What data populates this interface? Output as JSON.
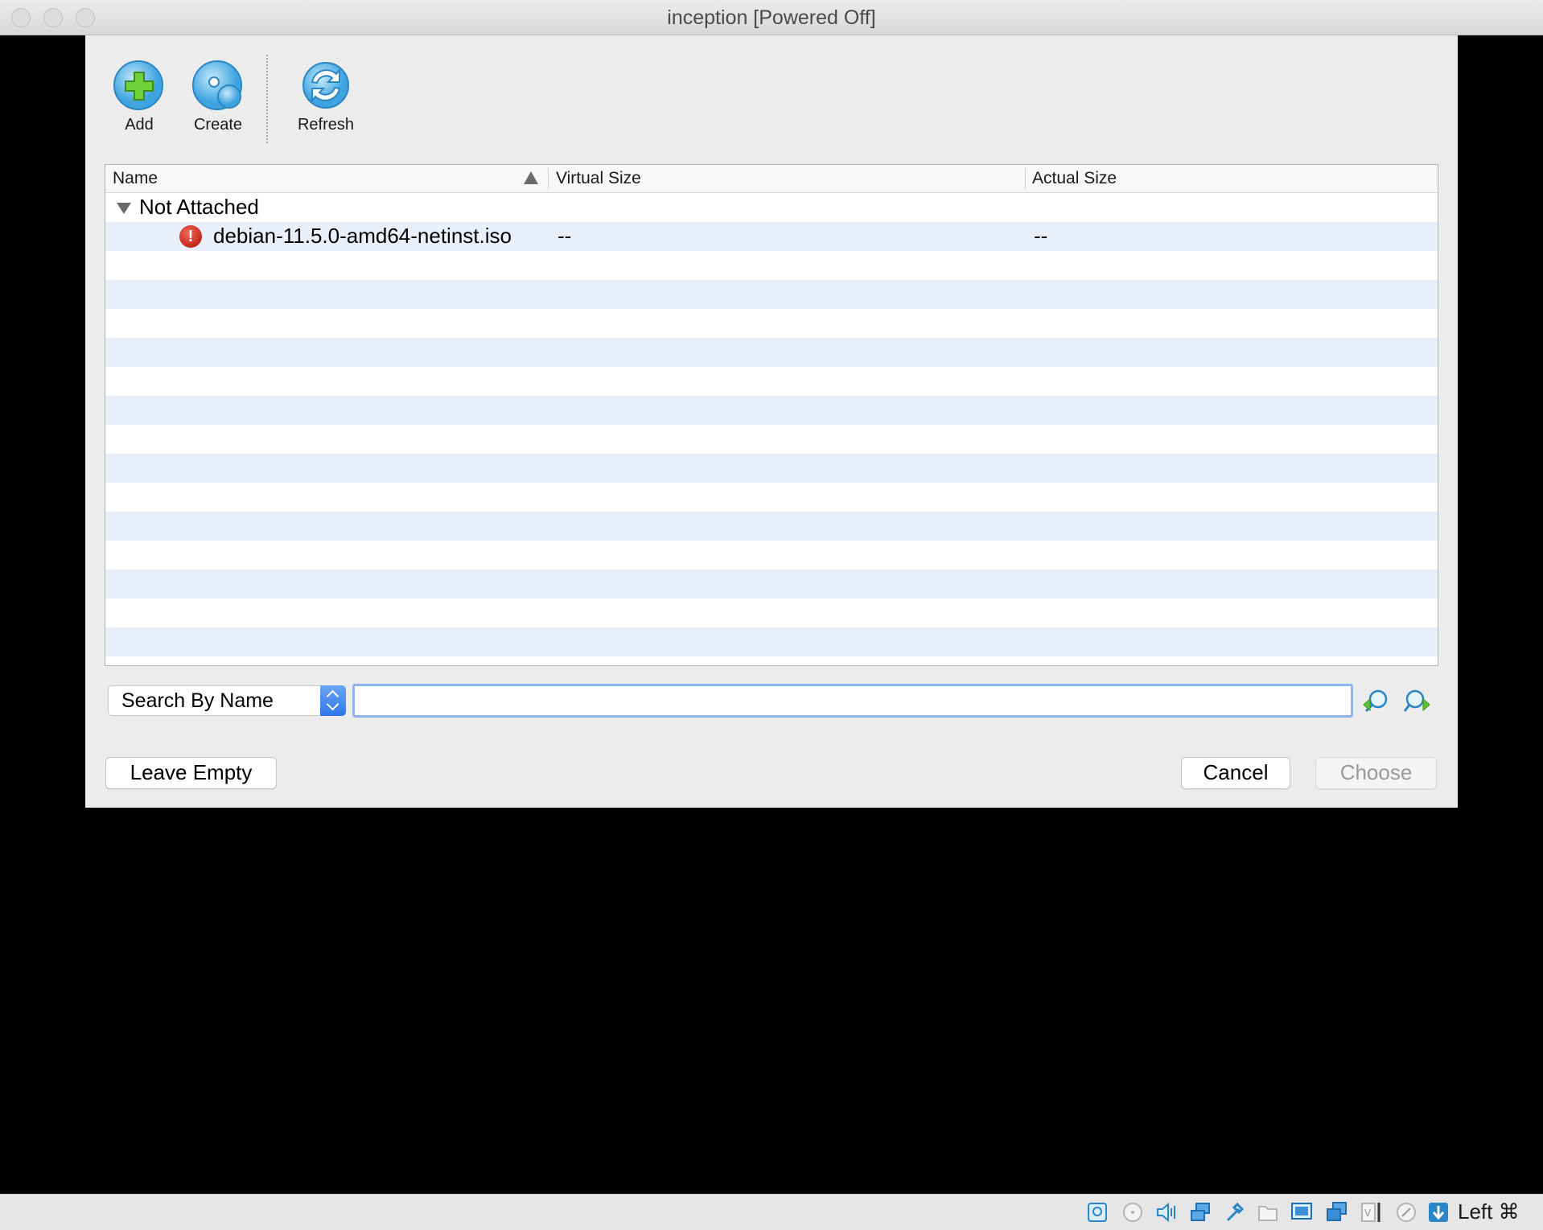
{
  "window": {
    "title": "inception [Powered Off]"
  },
  "toolbar": {
    "add_label": "Add",
    "create_label": "Create",
    "refresh_label": "Refresh"
  },
  "table": {
    "columns": [
      "Name",
      "Virtual Size",
      "Actual Size"
    ],
    "sort_column": "Name",
    "sort_direction": "ascending",
    "groups": [
      {
        "label": "Not Attached",
        "expanded": true,
        "items": [
          {
            "name": "debian-11.5.0-amd64-netinst.iso",
            "virtual_size": "--",
            "actual_size": "--",
            "status_icon": "error-icon"
          }
        ]
      }
    ]
  },
  "search": {
    "mode": "Search By Name",
    "value": "",
    "prev_icon": "search-previous-icon",
    "next_icon": "search-next-icon"
  },
  "buttons": {
    "leave_empty": "Leave Empty",
    "cancel": "Cancel",
    "choose": "Choose"
  },
  "statusbar": {
    "icons": [
      "hard-disk-icon",
      "optical-drive-icon",
      "audio-icon",
      "network-icon",
      "usb-icon",
      "shared-folders-icon",
      "display-icon",
      "recording-icon",
      "cpu-icon",
      "mouse-integration-icon",
      "keyboard-capture-icon"
    ],
    "host_key": "Left ⌘"
  },
  "colors": {
    "accent": "#2f76e8",
    "row_alt": "#eaf0fb",
    "error": "#c2281a"
  }
}
